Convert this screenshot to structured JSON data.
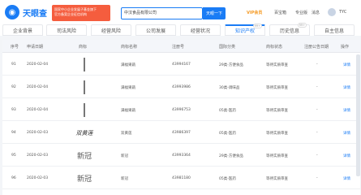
{
  "header": {
    "logo_text": "天眼查",
    "ad_lines": [
      "国家中小企业发展子基金旗下",
      "官方备案企业征信机构"
    ],
    "search_value": "中汉食品有限公司",
    "search_button": "天眼一下",
    "nav": [
      "VIP会员",
      "百宝箱",
      "专业版",
      "消息",
      "我的",
      "TYC"
    ]
  },
  "tabs": [
    {
      "label": "企业背景",
      "badge": ""
    },
    {
      "label": "司法风险",
      "badge": ""
    },
    {
      "label": "经营风险",
      "badge": ""
    },
    {
      "label": "公司发展",
      "badge": ""
    },
    {
      "label": "经营状况",
      "badge": ""
    },
    {
      "label": "知识产权",
      "badge": "99+"
    },
    {
      "label": "历史信息",
      "badge": "99+"
    },
    {
      "label": "自主信息",
      "badge": ""
    }
  ],
  "active_tab": 5,
  "table": {
    "columns": [
      "序号",
      "申请日期",
      "商标",
      "商标名称",
      "注册号",
      "国际分类",
      "商标状态",
      "注册公告日期",
      "操作"
    ],
    "rows": [
      {
        "no": "91",
        "date": "2020-02-04",
        "name": "满福果蔬",
        "reg": "43994167",
        "class": "29类-方便食品",
        "status": "等待实质审查",
        "pub": "-",
        "op": "详情",
        "mark": "满福果蔬"
      },
      {
        "no": "92",
        "date": "2020-02-04",
        "name": "满福果蔬",
        "reg": "43993986",
        "class": "30类-调味品",
        "status": "等待实质审查",
        "pub": "-",
        "op": "详情",
        "mark": "满福果蔬"
      },
      {
        "no": "93",
        "date": "2020-02-04",
        "name": "满福果蔬",
        "reg": "43996753",
        "class": "05类-医药",
        "status": "等待实质审查",
        "pub": "-",
        "op": "详情",
        "mark": "满福果蔬"
      },
      {
        "no": "94",
        "date": "2020-02-03",
        "name": "双黄莲",
        "reg": "43986397",
        "class": "05类-医药",
        "status": "等待实质审查",
        "pub": "-",
        "op": "详情",
        "mark": "双黄莲"
      },
      {
        "no": "95",
        "date": "2020-02-03",
        "name": "新冠",
        "reg": "43993364",
        "class": "29类-方便食品",
        "status": "等待实质审查",
        "pub": "-",
        "op": "详情",
        "mark": "新冠"
      },
      {
        "no": "96",
        "date": "2020-02-03",
        "name": "新冠",
        "reg": "43981180",
        "class": "05类-医药",
        "status": "等待实质审查",
        "pub": "-",
        "op": "详情",
        "mark": "新冠"
      }
    ]
  }
}
